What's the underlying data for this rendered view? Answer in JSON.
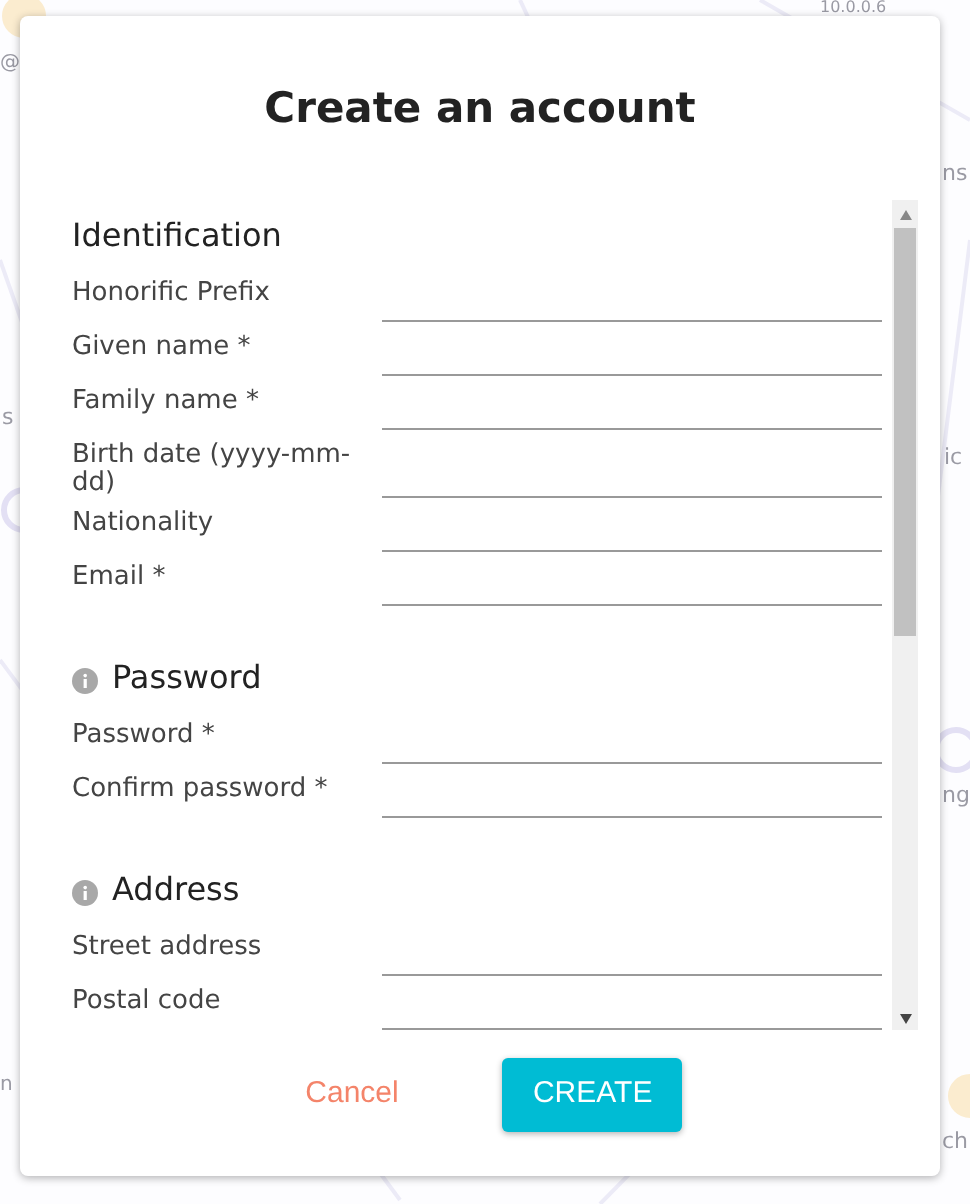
{
  "background": {
    "labels": [
      "10.0.0.6",
      "@",
      "ns",
      "s",
      "ic",
      "ng",
      "n",
      "ch"
    ]
  },
  "dialog": {
    "title": "Create an account",
    "sections": [
      {
        "title": "Identification",
        "info": false,
        "fields": [
          "Honorific Prefix",
          "Given name *",
          "Family name *",
          "Birth date (yyyy-mm-dd)",
          "Nationality",
          "Email *"
        ]
      },
      {
        "title": "Password",
        "info": true,
        "fields": [
          "Password *",
          "Confirm password *"
        ]
      },
      {
        "title": "Address",
        "info": true,
        "fields": [
          "Street address",
          "Postal code"
        ]
      }
    ],
    "cancel": "Cancel",
    "create": "CREATE"
  }
}
